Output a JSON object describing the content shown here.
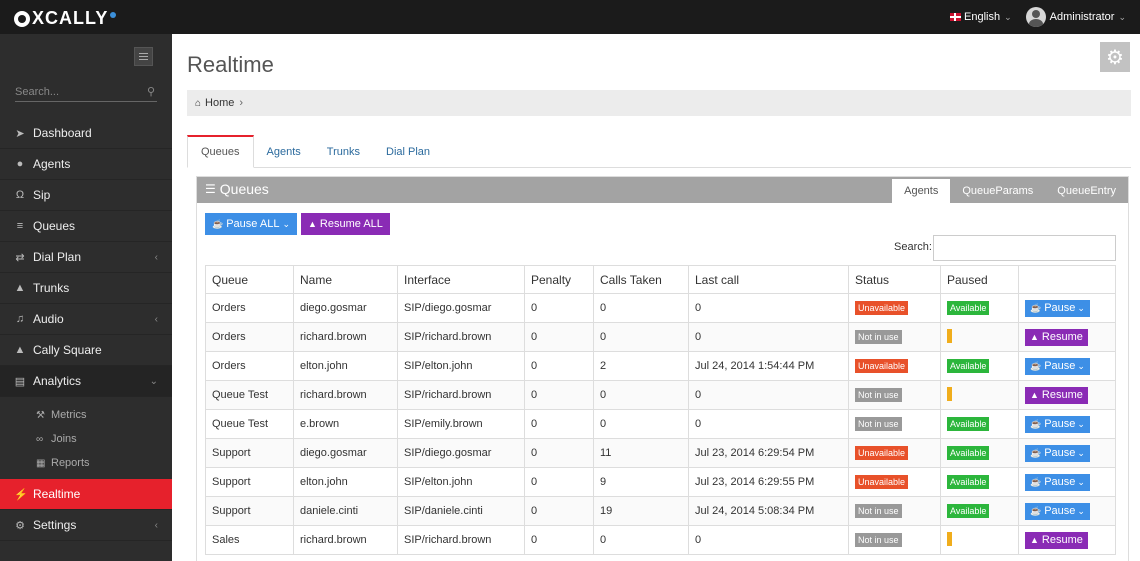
{
  "app": {
    "logo": "XCALLY",
    "language": "English",
    "user": "Administrator"
  },
  "sidebar": {
    "search_placeholder": "Search...",
    "items": [
      {
        "label": "Dashboard",
        "icon": "rocket-icon"
      },
      {
        "label": "Agents",
        "icon": "user-icon"
      },
      {
        "label": "Sip",
        "icon": "headset-icon"
      },
      {
        "label": "Queues",
        "icon": "list-icon"
      },
      {
        "label": "Dial Plan",
        "icon": "shuffle-icon"
      },
      {
        "label": "Trunks",
        "icon": "sitemap-icon"
      },
      {
        "label": "Audio",
        "icon": "music-icon"
      },
      {
        "label": "Cally Square",
        "icon": "sitemap-icon"
      },
      {
        "label": "Analytics",
        "icon": "bar-chart-icon"
      },
      {
        "label": "Realtime",
        "icon": "bolt-icon"
      },
      {
        "label": "Settings",
        "icon": "gear-icon"
      }
    ],
    "analytics_sub": [
      {
        "label": "Metrics"
      },
      {
        "label": "Joins"
      },
      {
        "label": "Reports"
      }
    ]
  },
  "main": {
    "title": "Realtime",
    "breadcrumb": "Home",
    "tabs": [
      "Queues",
      "Agents",
      "Trunks",
      "Dial Plan"
    ],
    "panel": {
      "title": "Queues",
      "tabs": [
        "Agents",
        "QueueParams",
        "QueueEntry"
      ],
      "pause_all": "Pause ALL",
      "resume_all": "Resume ALL",
      "search_label": "Search:"
    },
    "table": {
      "headers": [
        "Queue",
        "Name",
        "Interface",
        "Penalty",
        "Calls Taken",
        "Last call",
        "Status",
        "Paused",
        ""
      ],
      "rows": [
        {
          "queue": "Orders",
          "name": "diego.gosmar",
          "interface": "SIP/diego.gosmar",
          "penalty": "0",
          "calls": "0",
          "last": "0",
          "status": "Unavailable",
          "paused": "Available",
          "action": "Pause"
        },
        {
          "queue": "Orders",
          "name": "richard.brown",
          "interface": "SIP/richard.brown",
          "penalty": "0",
          "calls": "0",
          "last": "0",
          "status": "Not in use",
          "paused": "",
          "action": "Resume"
        },
        {
          "queue": "Orders",
          "name": "elton.john",
          "interface": "SIP/elton.john",
          "penalty": "0",
          "calls": "2",
          "last": "Jul 24, 2014 1:54:44 PM",
          "status": "Unavailable",
          "paused": "Available",
          "action": "Pause"
        },
        {
          "queue": "Queue Test",
          "name": "richard.brown",
          "interface": "SIP/richard.brown",
          "penalty": "0",
          "calls": "0",
          "last": "0",
          "status": "Not in use",
          "paused": "",
          "action": "Resume"
        },
        {
          "queue": "Queue Test",
          "name": "e.brown",
          "interface": "SIP/emily.brown",
          "penalty": "0",
          "calls": "0",
          "last": "0",
          "status": "Not in use",
          "paused": "Available",
          "action": "Pause"
        },
        {
          "queue": "Support",
          "name": "diego.gosmar",
          "interface": "SIP/diego.gosmar",
          "penalty": "0",
          "calls": "11",
          "last": "Jul 23, 2014 6:29:54 PM",
          "status": "Unavailable",
          "paused": "Available",
          "action": "Pause"
        },
        {
          "queue": "Support",
          "name": "elton.john",
          "interface": "SIP/elton.john",
          "penalty": "0",
          "calls": "9",
          "last": "Jul 23, 2014 6:29:55 PM",
          "status": "Unavailable",
          "paused": "Available",
          "action": "Pause"
        },
        {
          "queue": "Support",
          "name": "daniele.cinti",
          "interface": "SIP/daniele.cinti",
          "penalty": "0",
          "calls": "19",
          "last": "Jul 24, 2014 5:08:34 PM",
          "status": "Not in use",
          "paused": "Available",
          "action": "Pause"
        },
        {
          "queue": "Sales",
          "name": "richard.brown",
          "interface": "SIP/richard.brown",
          "penalty": "0",
          "calls": "0",
          "last": "0",
          "status": "Not in use",
          "paused": "",
          "action": "Resume"
        }
      ]
    }
  }
}
